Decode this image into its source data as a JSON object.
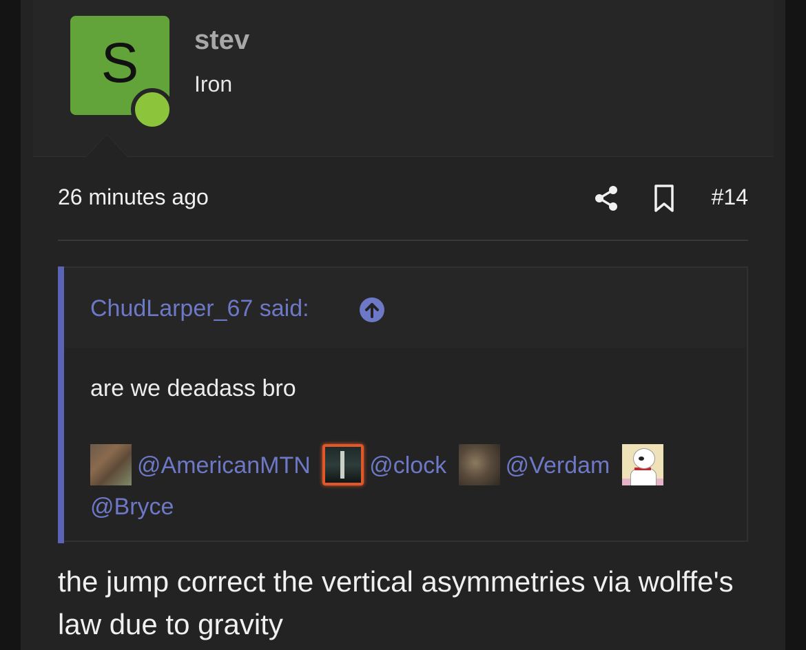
{
  "user": {
    "avatar_letter": "S",
    "name": "stev",
    "title": "Iron",
    "online_color": "#8cc43c",
    "avatar_color": "#62a43a"
  },
  "post": {
    "timestamp": "26 minutes ago",
    "number": "#14",
    "body": "the jump correct the vertical asymmetries via wolffe's law due to gravity"
  },
  "quote": {
    "author_line": "ChudLarper_67 said:",
    "text": "are we deadass bro",
    "mentions": [
      {
        "handle": "@AmericanMTN",
        "avatar": "highland-cow-avatar"
      },
      {
        "handle": "@clock",
        "avatar": "clock-avatar"
      },
      {
        "handle": "@Verdam",
        "avatar": "verdam-avatar"
      },
      {
        "handle": "@Bryce",
        "avatar": "cartoon-dog-avatar"
      }
    ]
  },
  "icons": {
    "share": "share-icon",
    "bookmark": "bookmark-icon",
    "jump": "arrow-up-circle-icon"
  },
  "colors": {
    "accent": "#6d78c6",
    "quote_bar": "#5a63b5",
    "background": "#232323"
  }
}
